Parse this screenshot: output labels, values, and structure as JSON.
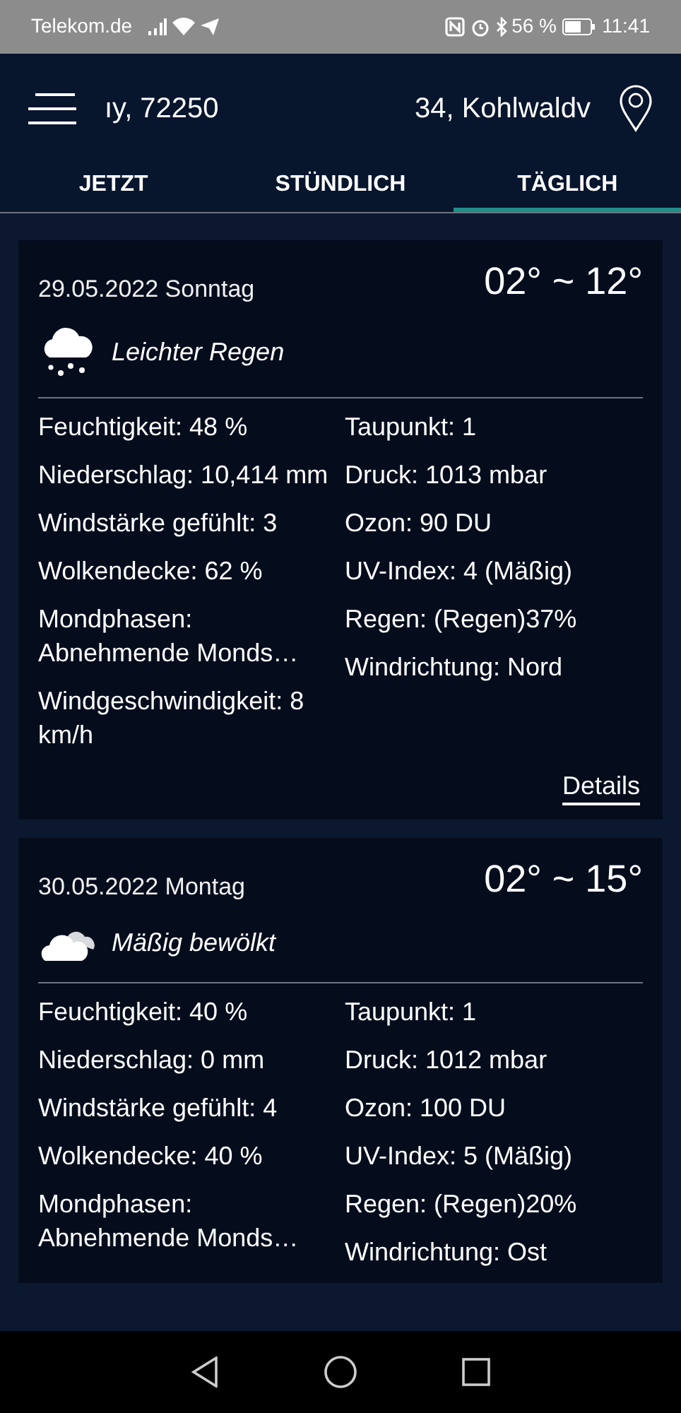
{
  "status_bar": {
    "carrier": "Telekom.de",
    "battery": "56 %",
    "time": "11:41"
  },
  "header": {
    "location_parts": [
      "ıy, 72250",
      "34, Kohlwaldv"
    ]
  },
  "tabs": [
    {
      "label": "JETZT",
      "selected": false
    },
    {
      "label": "STÜNDLICH",
      "selected": false
    },
    {
      "label": "TÄGLICH",
      "selected": true
    }
  ],
  "days": [
    {
      "date": "29.05.2022 Sonntag",
      "temp": "02° ~ 12°",
      "kind": "rain",
      "condition": "Leichter Regen",
      "left": [
        "Feuchtigkeit: 48 %",
        "Niederschlag: 10,414 mm",
        "Windstärke gefühlt: 3",
        "Wolkendecke: 62 %",
        "Mondphasen: Abnehmende Monds…",
        "Windgeschwindigkeit: 8 km/h"
      ],
      "right": [
        "Taupunkt: 1",
        "Druck: 1013 mbar",
        "Ozon: 90 DU",
        "UV-Index: 4 (Mäßig)",
        "Regen: (Regen)37%",
        "Windrichtung: Nord"
      ],
      "details": "Details"
    },
    {
      "date": "30.05.2022 Montag",
      "temp": "02° ~ 15°",
      "kind": "cloudy",
      "condition": "Mäßig bewölkt",
      "left": [
        "Feuchtigkeit: 40 %",
        "Niederschlag: 0 mm",
        "Windstärke gefühlt: 4",
        "Wolkendecke: 40 %",
        "Mondphasen: Abnehmende Monds…"
      ],
      "right": [
        "Taupunkt: 1",
        "Druck: 1012 mbar",
        "Ozon: 100 DU",
        "UV-Index: 5 (Mäßig)",
        "Regen: (Regen)20%",
        "Windrichtung: Ost"
      ]
    }
  ]
}
